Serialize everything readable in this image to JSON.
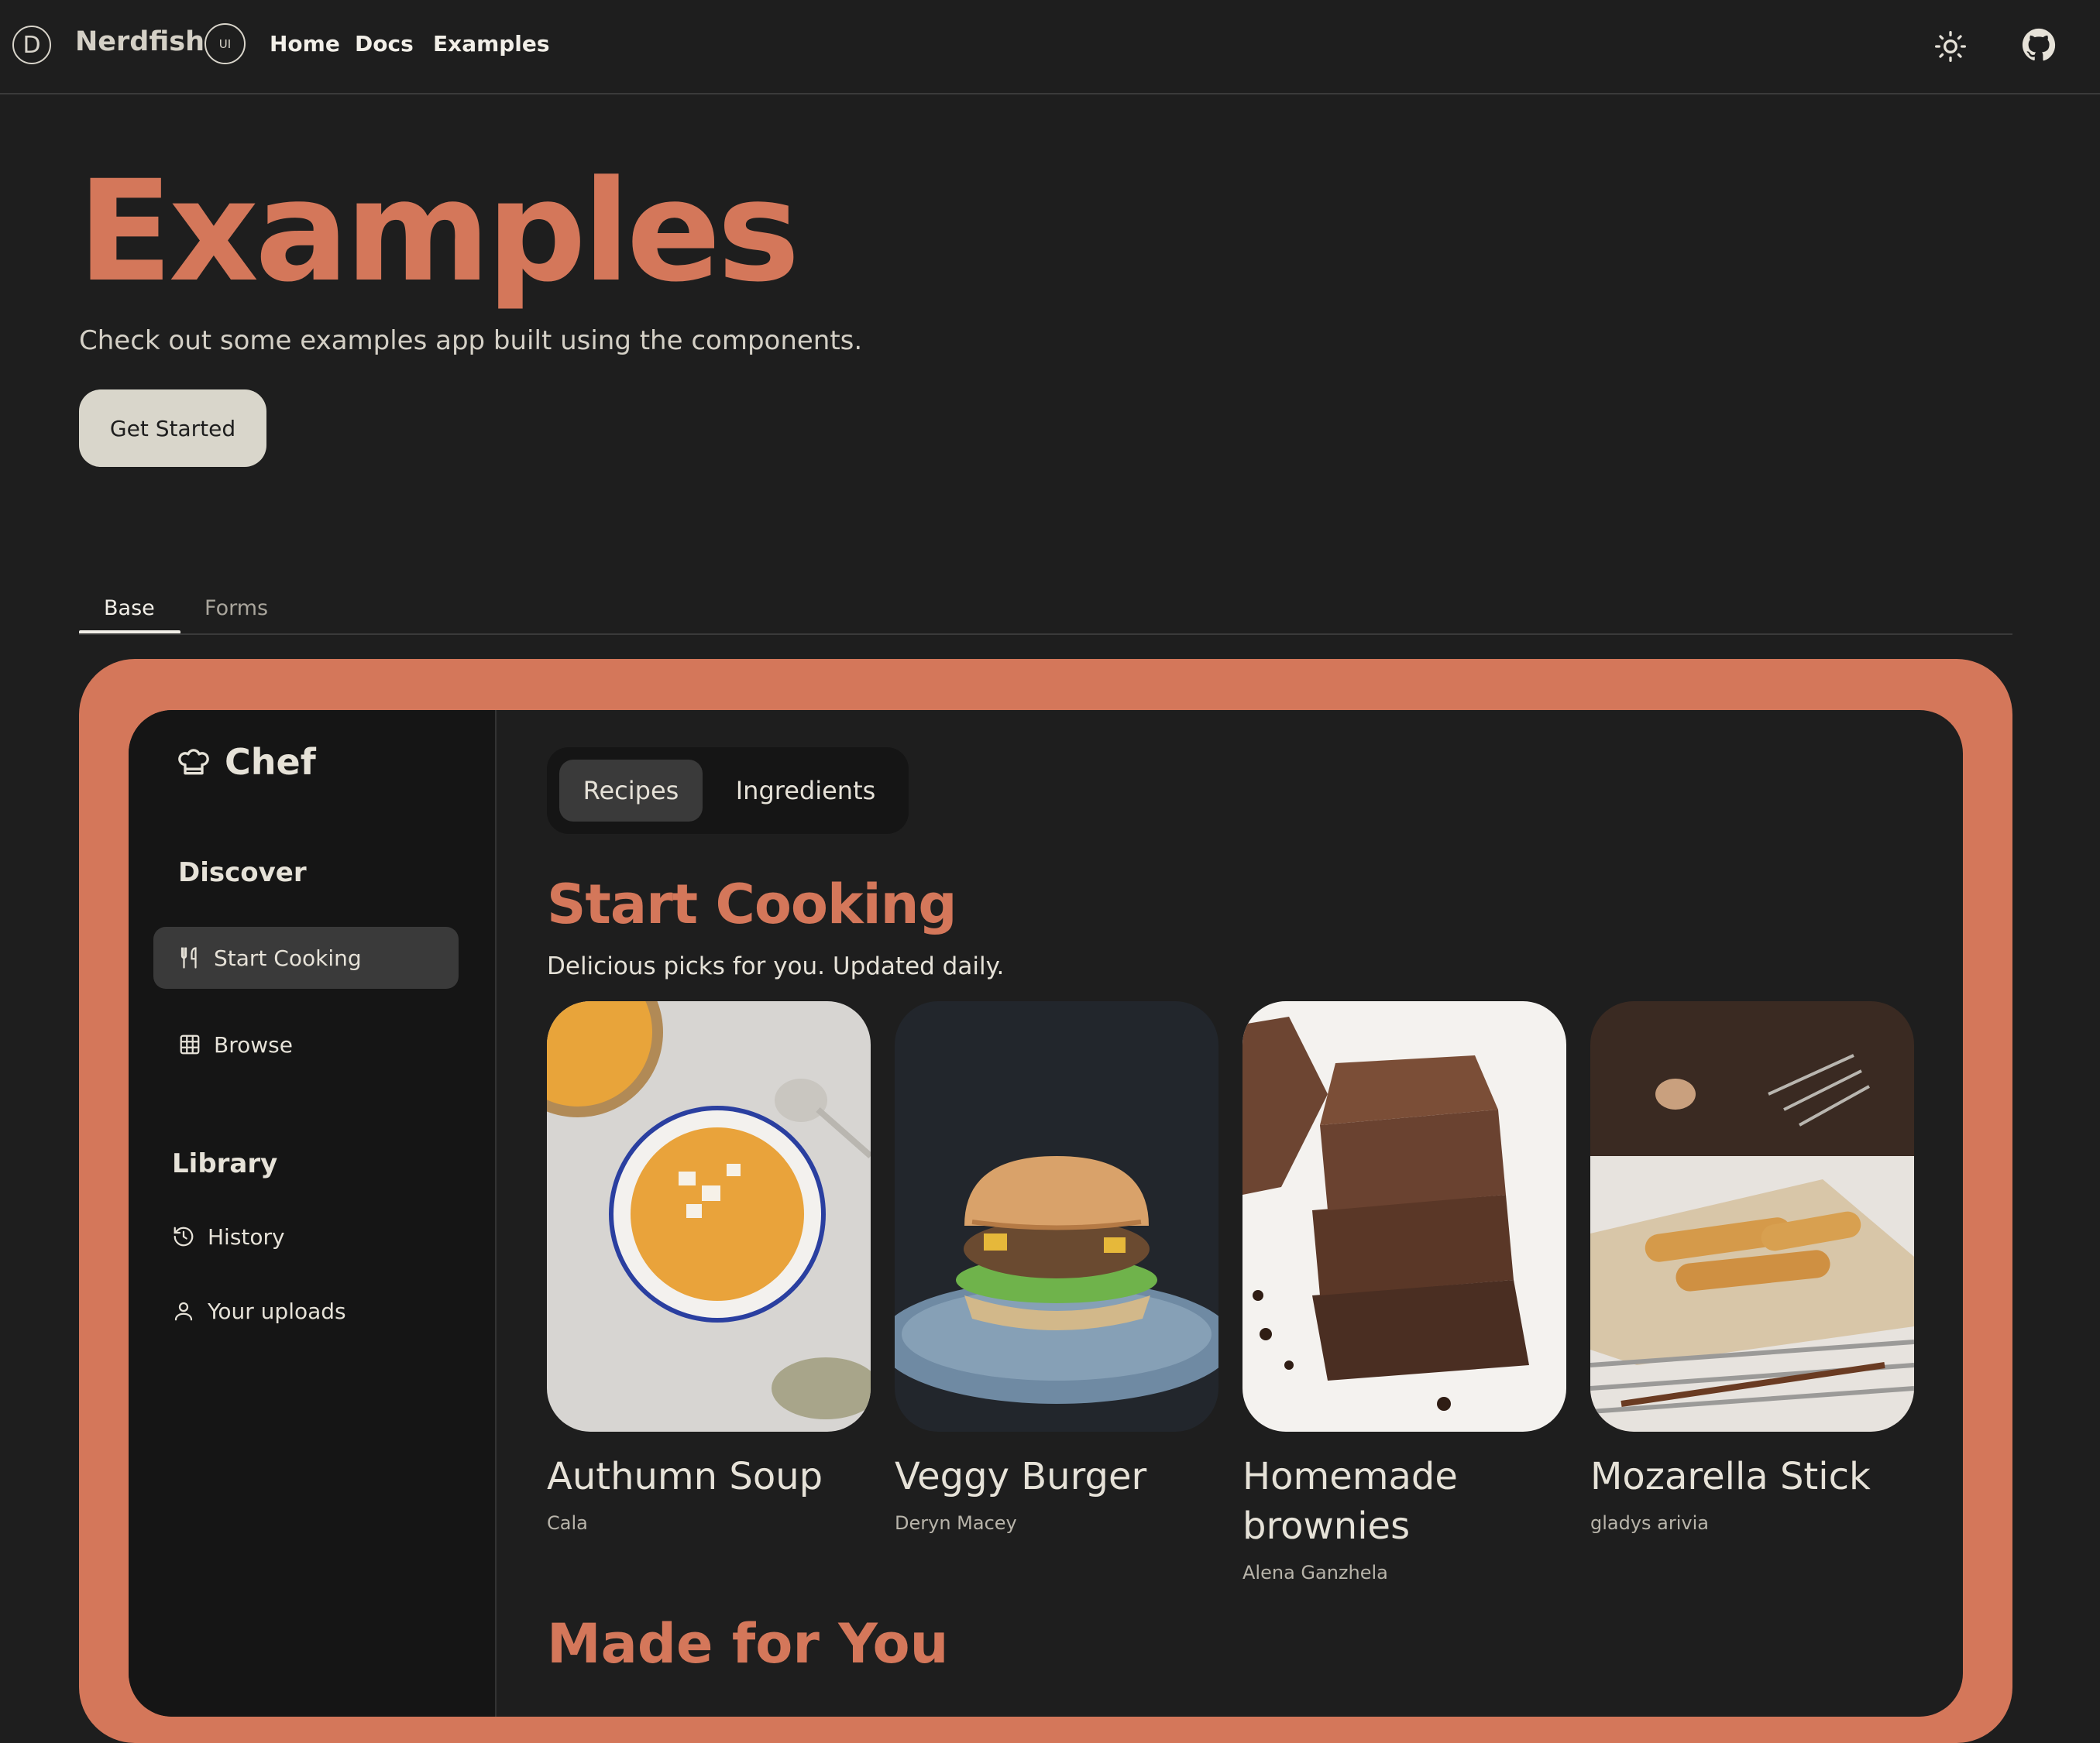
{
  "header": {
    "logo_glyph": "D",
    "brand": "Nerdfish",
    "badge": "UI",
    "nav": [
      {
        "label": "Home"
      },
      {
        "label": "Docs"
      },
      {
        "label": "Examples"
      }
    ],
    "theme_icon": "sun-icon",
    "github_icon": "github-icon"
  },
  "hero": {
    "title": "Examples",
    "subtitle": "Check out some examples app built using the components.",
    "cta": "Get Started"
  },
  "tabs": [
    {
      "label": "Base",
      "active": true
    },
    {
      "label": "Forms",
      "active": false
    }
  ],
  "app": {
    "logo_label": "Chef",
    "sidebar": {
      "discover_heading": "Discover",
      "discover_items": [
        {
          "label": "Start Cooking",
          "icon": "utensils-icon",
          "active": true
        },
        {
          "label": "Browse",
          "icon": "grid-icon",
          "active": false
        }
      ],
      "library_heading": "Library",
      "library_items": [
        {
          "label": "History",
          "icon": "history-icon"
        },
        {
          "label": "Your uploads",
          "icon": "user-icon"
        }
      ]
    },
    "segments": [
      {
        "label": "Recipes",
        "active": true
      },
      {
        "label": "Ingredients",
        "active": false
      }
    ],
    "section_title": "Start Cooking",
    "section_subtitle": "Delicious picks for you. Updated daily.",
    "cards": [
      {
        "title": "Authumn Soup",
        "author": "Cala"
      },
      {
        "title": "Veggy Burger",
        "author": "Deryn Macey"
      },
      {
        "title": "Homemade brownies",
        "author": "Alena Ganzhela"
      },
      {
        "title": "Mozarella Stick",
        "author": "gladys arivia"
      }
    ],
    "next_section_title": "Made for You"
  },
  "colors": {
    "accent": "#d4775a",
    "background": "#1e1e1e",
    "sidebar": "#151515",
    "button": "#d9d6cb"
  }
}
